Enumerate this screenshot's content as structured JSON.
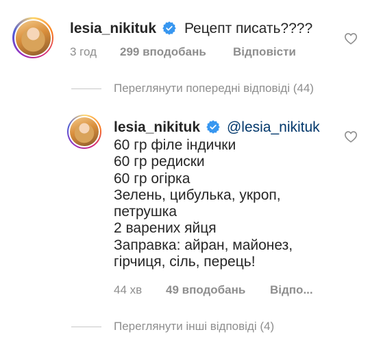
{
  "comment1": {
    "username": "lesia_nikituk",
    "text": "Рецепт писать????",
    "time": "3 год",
    "likes": "299 вподобань",
    "reply": "Відповісти"
  },
  "view_previous": "Переглянути попередні відповіді (44)",
  "comment2": {
    "username": "lesia_nikituk",
    "mention": "@lesia_nikituk",
    "lines": [
      "60 гр філе індички",
      "60 гр редиски",
      "60 гр огірка",
      "Зелень, цибулька, укроп,",
      "петрушка",
      "2 варених яйця",
      "Заправка: айран, майонез,",
      "гірчиця, сіль, перець!"
    ],
    "time": "44 хв",
    "likes": "49 вподобань",
    "reply": "Відпо..."
  },
  "view_more": "Переглянути інші відповіді (4)",
  "icons": {
    "verified": "verified-badge-icon",
    "like": "heart-icon",
    "verified_color": "#3897f0"
  }
}
